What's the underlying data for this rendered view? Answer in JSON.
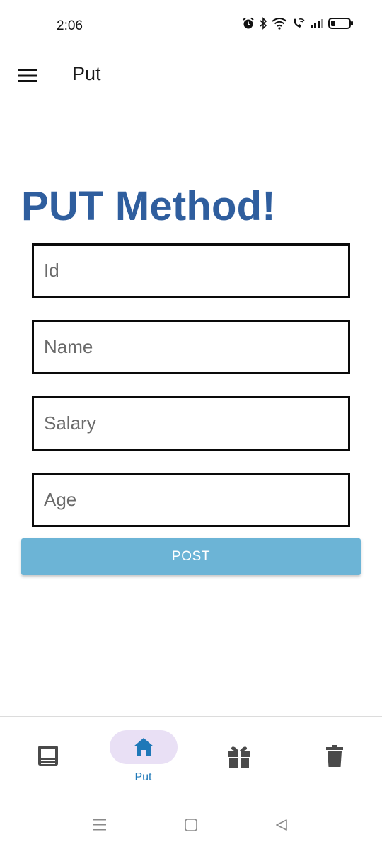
{
  "status_bar": {
    "time": "2:06",
    "icons": [
      "alarm-icon",
      "bluetooth-icon",
      "wifi-icon",
      "wifi-calling-icon",
      "signal-icon",
      "battery-icon"
    ]
  },
  "app_bar": {
    "title": "Put",
    "menu_icon": "hamburger-menu-icon"
  },
  "main": {
    "heading": "PUT Method!",
    "fields": [
      {
        "placeholder": "Id",
        "value": ""
      },
      {
        "placeholder": "Name",
        "value": ""
      },
      {
        "placeholder": "Salary",
        "value": ""
      },
      {
        "placeholder": "Age",
        "value": ""
      }
    ],
    "submit_label": "POST"
  },
  "bottom_nav": {
    "items": [
      {
        "icon": "list-icon",
        "label": "",
        "active": false
      },
      {
        "icon": "home-icon",
        "label": "Put",
        "active": true
      },
      {
        "icon": "gift-icon",
        "label": "",
        "active": false
      },
      {
        "icon": "trash-icon",
        "label": "",
        "active": false
      }
    ]
  },
  "system_nav": {
    "icons": [
      "recents-icon",
      "home-square-icon",
      "back-triangle-icon"
    ]
  },
  "colors": {
    "heading": "#2f5e9e",
    "button": "#6cb4d6",
    "active_pill": "#e9e0f5",
    "active_label": "#1e78b8",
    "field_border": "#0a0a0a"
  }
}
